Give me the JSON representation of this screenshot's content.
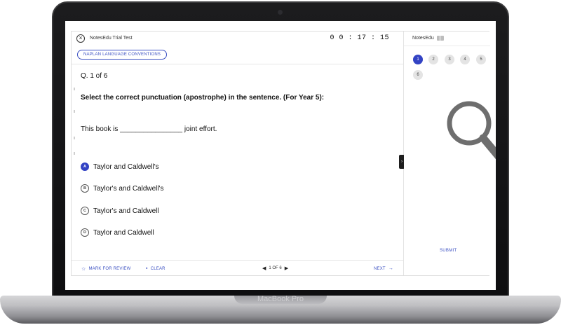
{
  "device": {
    "brand_label": "MacBook Pro"
  },
  "app": {
    "test_title": "NotesEdu Trial Test",
    "timer": "0 0 : 17 : 15",
    "category": "NAPLAN LANGUAGE CONVENTIONS",
    "question_number": "Q. 1 of 6",
    "question": "Select the correct punctuation (apostrophe) in the sentence. (For Year 5):",
    "sentence": "This book is ________________ joint effort.",
    "options": [
      {
        "letter": "A",
        "text": "Taylor and Caldwell's",
        "selected": true
      },
      {
        "letter": "B",
        "text": "Taylor's and Caldwell's",
        "selected": false
      },
      {
        "letter": "C",
        "text": "Taylor's and Caldwell",
        "selected": false
      },
      {
        "letter": "D",
        "text": "Taylor and Caldwell",
        "selected": false
      }
    ],
    "footer": {
      "mark_for_review": "MARK FOR REVIEW",
      "clear": "CLEAR",
      "pager": "1 OF 6",
      "next": "NEXT"
    },
    "sidebar": {
      "brand": "NotesEdu",
      "questions": [
        "1",
        "2",
        "3",
        "4",
        "5",
        "6"
      ],
      "current": "1",
      "submit": "SUBMIT"
    }
  },
  "colors": {
    "accent": "#3343c4",
    "frame": "#1c1c1e"
  },
  "icons": [
    "close-icon",
    "book-icon",
    "star-icon",
    "trash-icon",
    "chevron-left-icon",
    "chevron-right-icon",
    "arrow-right-icon",
    "magnifier-icon"
  ]
}
